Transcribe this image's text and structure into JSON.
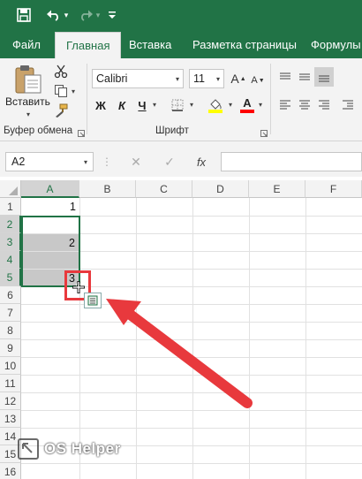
{
  "titlebar": {
    "save_icon": "save-icon",
    "undo_icon": "undo-icon",
    "redo_icon": "redo-icon",
    "customize_icon": "chevron-down-icon"
  },
  "tabs": [
    {
      "label": "Файл"
    },
    {
      "label": "Главная"
    },
    {
      "label": "Вставка"
    },
    {
      "label": "Разметка страницы"
    },
    {
      "label": "Формулы"
    }
  ],
  "ribbon": {
    "paste_label": "Вставить",
    "clipboard_group": "Буфер обмена",
    "font_group": "Шрифт",
    "font_name": "Calibri",
    "font_size": "11",
    "bold": "Ж",
    "italic": "К",
    "underline": "Ч",
    "increase_font": "A",
    "decrease_font": "A",
    "font_color_letter": "A",
    "highlight_color": "#ffff00",
    "font_color": "#ff0000"
  },
  "formula_bar": {
    "name_box": "A2",
    "fx": "fx",
    "cancel": "✕",
    "enter": "✓"
  },
  "sheet": {
    "columns": [
      "A",
      "B",
      "C",
      "D",
      "E",
      "F"
    ],
    "rows": [
      "1",
      "2",
      "3",
      "4",
      "5",
      "6",
      "7",
      "8",
      "9",
      "10",
      "11",
      "12",
      "13",
      "14",
      "15",
      "16"
    ],
    "cells": {
      "A1": "1",
      "A3": "2",
      "A5": "3"
    }
  },
  "watermark": {
    "text": "OS Helper"
  },
  "accent": "#217346",
  "annotation_color": "#e8393d"
}
